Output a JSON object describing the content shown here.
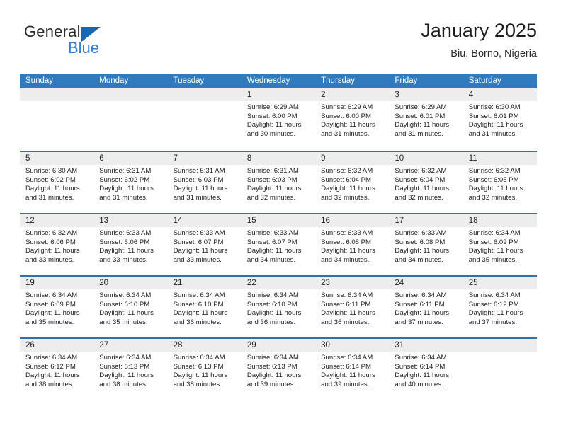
{
  "brand": {
    "name_part1": "General",
    "name_part2": "Blue",
    "triangle_icon": "blue-triangle-logo",
    "color_dark": "#2b2b2b",
    "color_blue": "#2f7fd1"
  },
  "header": {
    "title": "January 2025",
    "subtitle": "Biu, Borno, Nigeria"
  },
  "colors": {
    "header_row_bg": "#2f7bbd",
    "row_divider": "#2f6fae",
    "daynum_band_bg": "#ededed",
    "text": "#1d1d1d"
  },
  "weekdays": [
    "Sunday",
    "Monday",
    "Tuesday",
    "Wednesday",
    "Thursday",
    "Friday",
    "Saturday"
  ],
  "labels": {
    "sunrise_prefix": "Sunrise:",
    "sunset_prefix": "Sunset:",
    "daylight_prefix": "Daylight:"
  },
  "weeks": [
    [
      {
        "day": "",
        "empty": true
      },
      {
        "day": "",
        "empty": true
      },
      {
        "day": "",
        "empty": true
      },
      {
        "day": "1",
        "sunrise": "Sunrise: 6:29 AM",
        "sunset": "Sunset: 6:00 PM",
        "daylight": "Daylight: 11 hours and 30 minutes."
      },
      {
        "day": "2",
        "sunrise": "Sunrise: 6:29 AM",
        "sunset": "Sunset: 6:00 PM",
        "daylight": "Daylight: 11 hours and 31 minutes."
      },
      {
        "day": "3",
        "sunrise": "Sunrise: 6:29 AM",
        "sunset": "Sunset: 6:01 PM",
        "daylight": "Daylight: 11 hours and 31 minutes."
      },
      {
        "day": "4",
        "sunrise": "Sunrise: 6:30 AM",
        "sunset": "Sunset: 6:01 PM",
        "daylight": "Daylight: 11 hours and 31 minutes."
      }
    ],
    [
      {
        "day": "5",
        "sunrise": "Sunrise: 6:30 AM",
        "sunset": "Sunset: 6:02 PM",
        "daylight": "Daylight: 11 hours and 31 minutes."
      },
      {
        "day": "6",
        "sunrise": "Sunrise: 6:31 AM",
        "sunset": "Sunset: 6:02 PM",
        "daylight": "Daylight: 11 hours and 31 minutes."
      },
      {
        "day": "7",
        "sunrise": "Sunrise: 6:31 AM",
        "sunset": "Sunset: 6:03 PM",
        "daylight": "Daylight: 11 hours and 31 minutes."
      },
      {
        "day": "8",
        "sunrise": "Sunrise: 6:31 AM",
        "sunset": "Sunset: 6:03 PM",
        "daylight": "Daylight: 11 hours and 32 minutes."
      },
      {
        "day": "9",
        "sunrise": "Sunrise: 6:32 AM",
        "sunset": "Sunset: 6:04 PM",
        "daylight": "Daylight: 11 hours and 32 minutes."
      },
      {
        "day": "10",
        "sunrise": "Sunrise: 6:32 AM",
        "sunset": "Sunset: 6:04 PM",
        "daylight": "Daylight: 11 hours and 32 minutes."
      },
      {
        "day": "11",
        "sunrise": "Sunrise: 6:32 AM",
        "sunset": "Sunset: 6:05 PM",
        "daylight": "Daylight: 11 hours and 32 minutes."
      }
    ],
    [
      {
        "day": "12",
        "sunrise": "Sunrise: 6:32 AM",
        "sunset": "Sunset: 6:06 PM",
        "daylight": "Daylight: 11 hours and 33 minutes."
      },
      {
        "day": "13",
        "sunrise": "Sunrise: 6:33 AM",
        "sunset": "Sunset: 6:06 PM",
        "daylight": "Daylight: 11 hours and 33 minutes."
      },
      {
        "day": "14",
        "sunrise": "Sunrise: 6:33 AM",
        "sunset": "Sunset: 6:07 PM",
        "daylight": "Daylight: 11 hours and 33 minutes."
      },
      {
        "day": "15",
        "sunrise": "Sunrise: 6:33 AM",
        "sunset": "Sunset: 6:07 PM",
        "daylight": "Daylight: 11 hours and 34 minutes."
      },
      {
        "day": "16",
        "sunrise": "Sunrise: 6:33 AM",
        "sunset": "Sunset: 6:08 PM",
        "daylight": "Daylight: 11 hours and 34 minutes."
      },
      {
        "day": "17",
        "sunrise": "Sunrise: 6:33 AM",
        "sunset": "Sunset: 6:08 PM",
        "daylight": "Daylight: 11 hours and 34 minutes."
      },
      {
        "day": "18",
        "sunrise": "Sunrise: 6:34 AM",
        "sunset": "Sunset: 6:09 PM",
        "daylight": "Daylight: 11 hours and 35 minutes."
      }
    ],
    [
      {
        "day": "19",
        "sunrise": "Sunrise: 6:34 AM",
        "sunset": "Sunset: 6:09 PM",
        "daylight": "Daylight: 11 hours and 35 minutes."
      },
      {
        "day": "20",
        "sunrise": "Sunrise: 6:34 AM",
        "sunset": "Sunset: 6:10 PM",
        "daylight": "Daylight: 11 hours and 35 minutes."
      },
      {
        "day": "21",
        "sunrise": "Sunrise: 6:34 AM",
        "sunset": "Sunset: 6:10 PM",
        "daylight": "Daylight: 11 hours and 36 minutes."
      },
      {
        "day": "22",
        "sunrise": "Sunrise: 6:34 AM",
        "sunset": "Sunset: 6:10 PM",
        "daylight": "Daylight: 11 hours and 36 minutes."
      },
      {
        "day": "23",
        "sunrise": "Sunrise: 6:34 AM",
        "sunset": "Sunset: 6:11 PM",
        "daylight": "Daylight: 11 hours and 36 minutes."
      },
      {
        "day": "24",
        "sunrise": "Sunrise: 6:34 AM",
        "sunset": "Sunset: 6:11 PM",
        "daylight": "Daylight: 11 hours and 37 minutes."
      },
      {
        "day": "25",
        "sunrise": "Sunrise: 6:34 AM",
        "sunset": "Sunset: 6:12 PM",
        "daylight": "Daylight: 11 hours and 37 minutes."
      }
    ],
    [
      {
        "day": "26",
        "sunrise": "Sunrise: 6:34 AM",
        "sunset": "Sunset: 6:12 PM",
        "daylight": "Daylight: 11 hours and 38 minutes."
      },
      {
        "day": "27",
        "sunrise": "Sunrise: 6:34 AM",
        "sunset": "Sunset: 6:13 PM",
        "daylight": "Daylight: 11 hours and 38 minutes."
      },
      {
        "day": "28",
        "sunrise": "Sunrise: 6:34 AM",
        "sunset": "Sunset: 6:13 PM",
        "daylight": "Daylight: 11 hours and 38 minutes."
      },
      {
        "day": "29",
        "sunrise": "Sunrise: 6:34 AM",
        "sunset": "Sunset: 6:13 PM",
        "daylight": "Daylight: 11 hours and 39 minutes."
      },
      {
        "day": "30",
        "sunrise": "Sunrise: 6:34 AM",
        "sunset": "Sunset: 6:14 PM",
        "daylight": "Daylight: 11 hours and 39 minutes."
      },
      {
        "day": "31",
        "sunrise": "Sunrise: 6:34 AM",
        "sunset": "Sunset: 6:14 PM",
        "daylight": "Daylight: 11 hours and 40 minutes."
      },
      {
        "day": "",
        "empty": true
      }
    ]
  ]
}
